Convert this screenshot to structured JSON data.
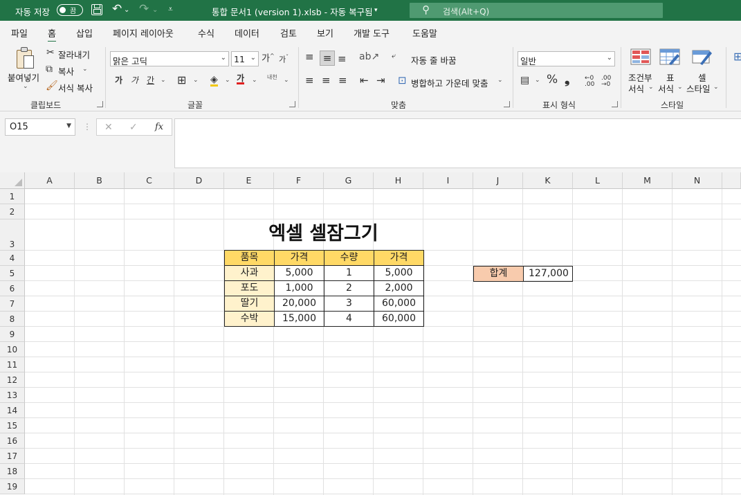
{
  "titlebar": {
    "autosave_label": "자동 저장",
    "autosave_state": "끔",
    "doc_title": "통합 문서1 (version 1).xlsb  -  자동 복구됨",
    "search_placeholder": "검색(Alt+Q)"
  },
  "menu": [
    "파일",
    "홈",
    "삽입",
    "페이지 레이아웃",
    "수식",
    "데이터",
    "검토",
    "보기",
    "개발 도구",
    "도움말"
  ],
  "ribbon": {
    "clipboard": {
      "paste": "붙여넣기",
      "cut": "잘라내기",
      "copy": "복사",
      "format_painter": "서식 복사",
      "label": "클립보드"
    },
    "font": {
      "family": "맑은 고딕",
      "size": "11",
      "label": "글꼴",
      "bold": "가",
      "italic": "가",
      "underline": "간",
      "font_color_glyph": "가",
      "phonetic": "내천"
    },
    "alignment": {
      "wrap_text": "자동 줄 바꿈",
      "merge_center": "병합하고 가운데 맞춤",
      "label": "맞춤"
    },
    "number": {
      "format": "일반",
      "label": "표시 형식",
      "percent": "%",
      "comma": "❟"
    },
    "styles": {
      "conditional": "조건부\n서식",
      "conditional_l1": "조건부",
      "conditional_l2": "서식",
      "table_l1": "표",
      "table_l2": "서식",
      "cell_l1": "셀",
      "cell_l2": "스타일",
      "label": "스타일"
    }
  },
  "formula_bar": {
    "name_box": "O15",
    "fx": "fx",
    "formula": ""
  },
  "columns": [
    "A",
    "B",
    "C",
    "D",
    "E",
    "F",
    "G",
    "H",
    "I",
    "J",
    "K",
    "L",
    "M",
    "N"
  ],
  "rows": [
    "1",
    "2",
    "3",
    "4",
    "5",
    "6",
    "7",
    "8",
    "9",
    "10",
    "11",
    "12",
    "13",
    "14",
    "15",
    "16",
    "17",
    "18",
    "19"
  ],
  "sheet": {
    "title": "엑셀 셀잠그기",
    "table_headers": [
      "품목",
      "가격",
      "수량",
      "가격"
    ],
    "table_rows": [
      [
        "사과",
        "5,000",
        "1",
        "5,000"
      ],
      [
        "포도",
        "1,000",
        "2",
        "2,000"
      ],
      [
        "딸기",
        "20,000",
        "3",
        "60,000"
      ],
      [
        "수박",
        "15,000",
        "4",
        "60,000"
      ]
    ],
    "total_label": "합계",
    "total_value": "127,000"
  },
  "colors": {
    "title_bar": "#217346",
    "header_fill": "#ffd966",
    "item_fill": "#fff2cc",
    "total_fill": "#f8cbad"
  }
}
